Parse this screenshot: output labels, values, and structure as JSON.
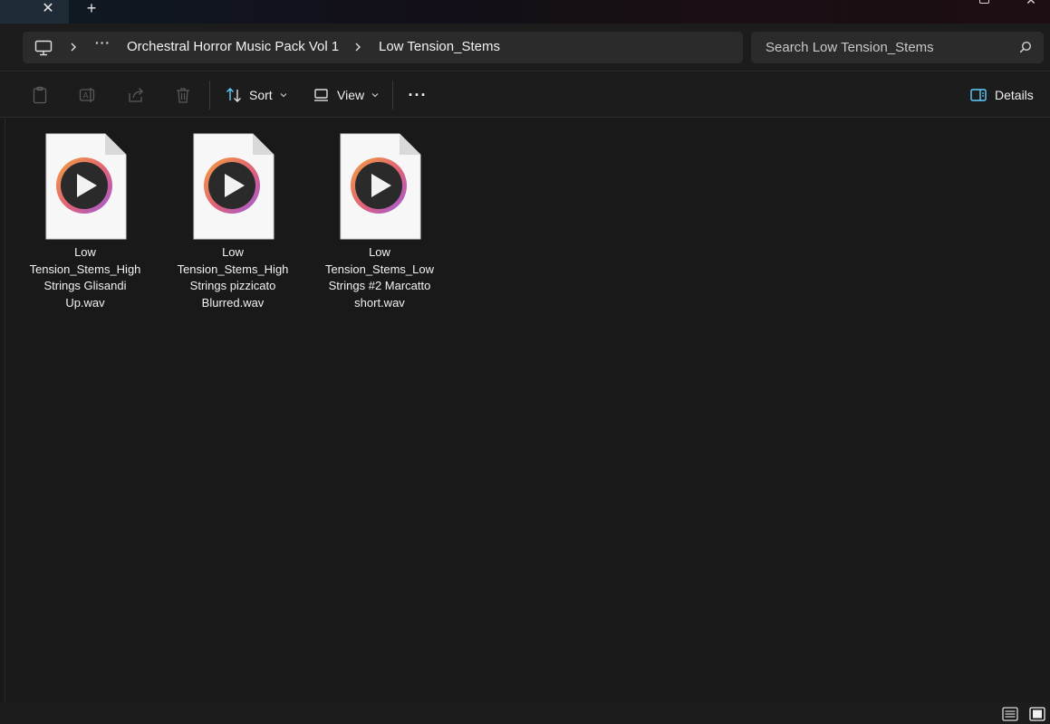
{
  "window": {
    "tab_close_glyph": "✕",
    "new_tab_glyph": "+",
    "close_glyph": "✕"
  },
  "address": {
    "more_glyph": "···",
    "crumbs": [
      "Orchestral Horror Music Pack Vol 1",
      "Low Tension_Stems"
    ]
  },
  "search": {
    "placeholder": "Search Low Tension_Stems"
  },
  "toolbar": {
    "sort_label": "Sort",
    "view_label": "View",
    "more_glyph": "···",
    "details_label": "Details"
  },
  "files": [
    {
      "name": "Low Tension_Stems_High Strings Glisandi Up.wav",
      "lines": [
        "Low",
        "Tension_Stems_High",
        "Strings Glisandi",
        "Up.wav"
      ]
    },
    {
      "name": "Low Tension_Stems_High Strings pizzicato Blurred.wav",
      "lines": [
        "Low",
        "Tension_Stems_High",
        "Strings pizzicato",
        "Blurred.wav"
      ]
    },
    {
      "name": "Low Tension_Stems_Low Strings #2 Marcatto short.wav",
      "lines": [
        "Low",
        "Tension_Stems_Low",
        "Strings #2 Marcatto",
        "short.wav"
      ]
    }
  ],
  "colors": {
    "background": "#191919",
    "bar": "#1c1c1c",
    "field": "#2b2b2b",
    "accent": "#60cdff"
  },
  "icons": {
    "pc": "computer-icon",
    "audio_file": "audio-file-icon",
    "search": "search-icon"
  }
}
